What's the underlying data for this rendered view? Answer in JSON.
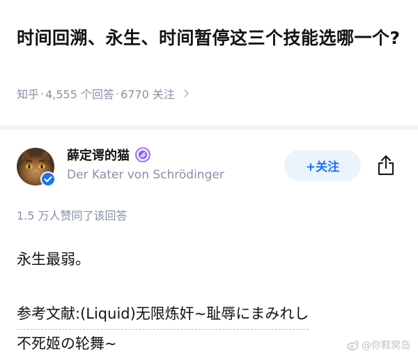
{
  "question": {
    "title": "时间回溯、永生、时间暂停这三个技能选哪一个?",
    "platform": "知乎",
    "answers_count": "4,555 个回答",
    "followers_count": "6770 关注"
  },
  "answer": {
    "author_name": "薛定谔的猫",
    "author_headline": "Der Kater von Schrödinger",
    "follow_label": "+关注",
    "approval_text": "1.5 万人赞同了该回答",
    "body_text": "永生最弱。",
    "reference_line1": "参考文献:(Liquid)无限炼奸~耻辱にまみれし",
    "reference_line2": "不死姬の轮舞~"
  },
  "watermark": {
    "text": "@你鞋窝岛"
  },
  "colors": {
    "accent_blue": "#1772f6",
    "follow_bg": "#ebf3fd",
    "meta_gray": "#8590a6",
    "badge_purple": "#8b5cf6"
  },
  "icons": {
    "meta_arrow": "chevron-right-icon",
    "verified": "verified-check-icon",
    "badge": "creator-badge-icon",
    "share": "share-icon",
    "watermark": "weibo-icon"
  }
}
